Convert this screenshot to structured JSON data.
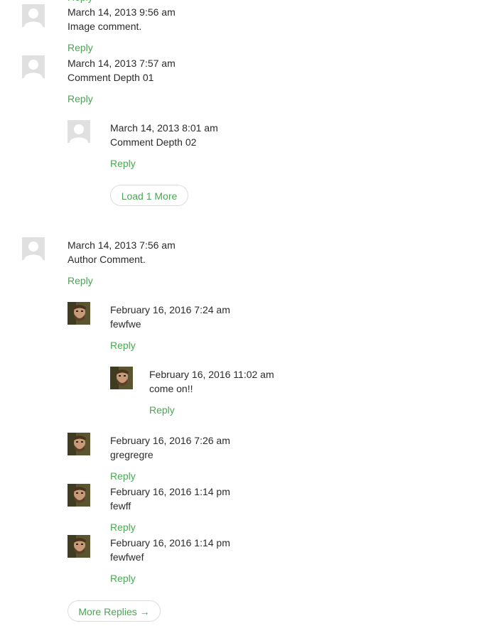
{
  "labels": {
    "reply": "Reply",
    "load_more": "Load 1 More",
    "more_replies": "More Replies →"
  },
  "comments": [
    {
      "date": "March 14, 2013 9:56 am",
      "text": "Image comment.",
      "avatar": "default-avatar-icon"
    },
    {
      "date": "March 14, 2013 7:57 am",
      "text": "Comment Depth 01",
      "avatar": "default-avatar-icon"
    },
    {
      "date": "March 14, 2013 8:01 am",
      "text": "Comment Depth 02",
      "avatar": "default-avatar-icon"
    },
    {
      "date": "March 14, 2013 7:56 am",
      "text": "Author Comment.",
      "avatar": "default-avatar-icon"
    },
    {
      "date": "February 16, 2016 7:24 am",
      "text": "fewfwe",
      "avatar": "user-photo-avatar"
    },
    {
      "date": "February 16, 2016 11:02 am",
      "text": "come on!!",
      "avatar": "user-photo-avatar"
    },
    {
      "date": "February 16, 2016 7:26 am",
      "text": "gregregre",
      "avatar": "user-photo-avatar"
    },
    {
      "date": "February 16, 2016 1:14 pm",
      "text": "fewff",
      "avatar": "user-photo-avatar"
    },
    {
      "date": "February 16, 2016 1:14 pm",
      "text": "fewfwef",
      "avatar": "user-photo-avatar"
    }
  ]
}
